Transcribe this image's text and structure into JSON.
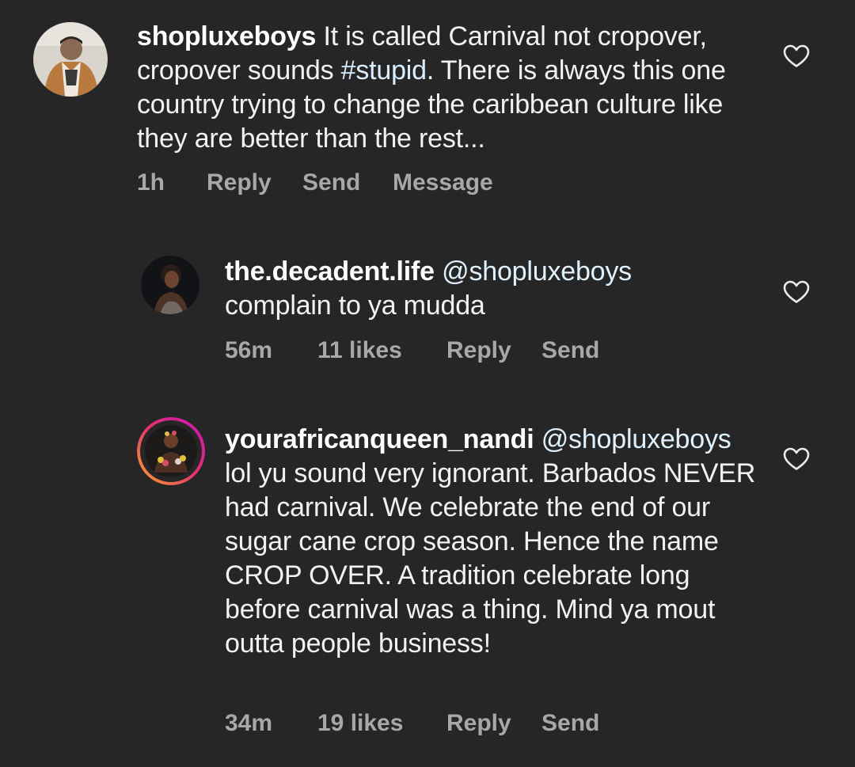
{
  "comments": [
    {
      "username": "shopluxeboys",
      "mention": "",
      "text_before": "It is called Carnival not cropover, cropover sounds",
      "hashtag": "#stupid",
      "text_after": ". There is always this one country trying to change the caribbean culture like they are better than the rest...",
      "time": "1h",
      "likes": "",
      "reply_label": "Reply",
      "send_label": "Send",
      "message_label": "Message"
    },
    {
      "username": "the.decadent.life",
      "mention": "@shopluxeboys",
      "text": "complain to ya mudda",
      "time": "56m",
      "likes": "11 likes",
      "reply_label": "Reply",
      "send_label": "Send"
    },
    {
      "username": "yourafricanqueen_nandi",
      "mention": "@shopluxeboys",
      "text": "lol yu sound very ignorant. Barbados NEVER had carnival. We celebrate the end of our sugar cane crop season. Hence the name CROP OVER. A tradition celebrate long before carnival was a thing. Mind ya mout outta people business!",
      "time": "34m",
      "likes": "19 likes",
      "reply_label": "Reply",
      "send_label": "Send"
    }
  ],
  "icons": {
    "like": "heart-outline-icon"
  },
  "colors": {
    "background": "#262626",
    "text": "#f2f2f2",
    "meta": "#a8a8a8",
    "story_ring_start": "#f9a12e",
    "story_ring_end": "#c913b9"
  }
}
